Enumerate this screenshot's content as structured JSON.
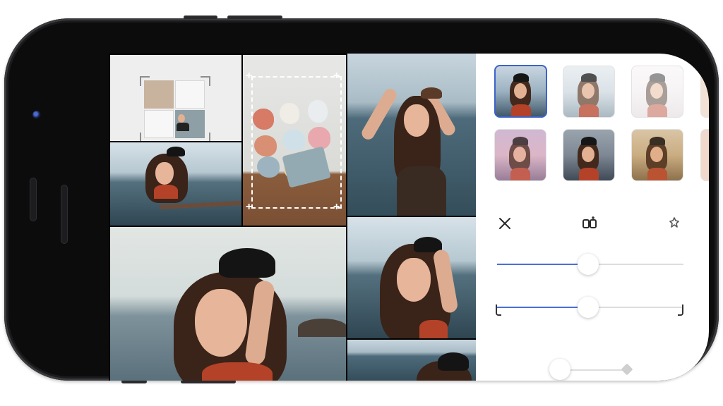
{
  "device": {
    "model": "smartphone-landscape"
  },
  "collage": {
    "tiles": [
      {
        "name": "template-tile",
        "content": "collage-layout-template"
      },
      {
        "name": "photo-small",
        "content": "portrait-by-sea"
      },
      {
        "name": "petals-tile",
        "content": "paper-petals"
      },
      {
        "name": "photo-top-right",
        "content": "portrait-by-sea-arms-raised"
      },
      {
        "name": "photo-large",
        "content": "portrait-with-hat"
      },
      {
        "name": "photo-mid-right",
        "content": "portrait-hand-in-hair"
      },
      {
        "name": "photo-bottom-right",
        "content": "portrait-partial"
      }
    ]
  },
  "editor": {
    "filters": [
      {
        "name": "filter-original",
        "selected": true,
        "tint": "#000000"
      },
      {
        "name": "filter-faded",
        "selected": false,
        "tint": "#ffffff"
      },
      {
        "name": "filter-bright",
        "selected": false,
        "tint": "#ffffff"
      },
      {
        "name": "filter-rose",
        "selected": false,
        "tint": "#f0b8c8"
      },
      {
        "name": "filter-cool",
        "selected": false,
        "tint": "#556070"
      },
      {
        "name": "filter-warm",
        "selected": false,
        "tint": "#d8a060"
      }
    ],
    "tools": [
      "close-icon",
      "compare-icon",
      "auto-enhance-icon"
    ],
    "sliders": [
      {
        "name": "adjust-slider-1",
        "value": 0.5
      },
      {
        "name": "adjust-slider-2",
        "value": 0.5
      },
      {
        "name": "adjust-slider-3",
        "value": 0.1
      }
    ],
    "accent_color": "#4a6fd6"
  }
}
